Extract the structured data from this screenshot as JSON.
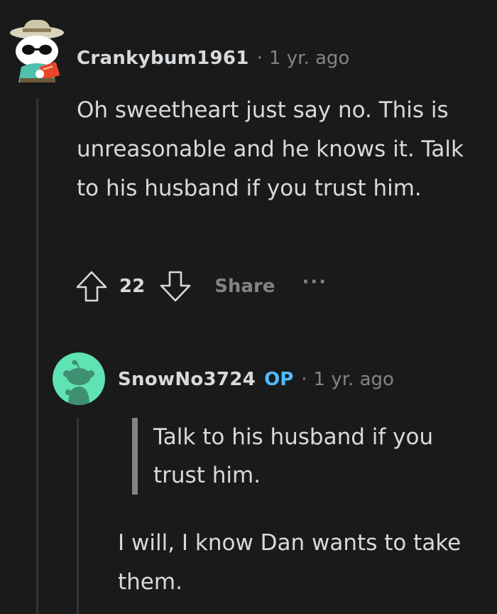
{
  "comments": [
    {
      "author": "Crankybum1961",
      "separator": "·",
      "time": "1 yr. ago",
      "body": "Oh sweetheart just say no. This is unreasonable and he knows it. Talk to his husband if you trust him.",
      "score": "22",
      "share_label": "Share",
      "more_label": "···"
    },
    {
      "author": "SnowNo3724",
      "op_badge": "OP",
      "separator": "·",
      "time": "1 yr. ago",
      "quote": "Talk to his husband if you trust him.",
      "body": "I will, I know Dan wants to take them."
    }
  ],
  "colors": {
    "background": "#1a1a1b",
    "text": "#d7dadc",
    "muted": "#818384",
    "op": "#4fbcff",
    "avatar2_bg": "#5fe3b3"
  },
  "icons": [
    "upvote-arrow-icon",
    "downvote-arrow-icon",
    "snoo-avatar",
    "snoo-default-avatar"
  ]
}
